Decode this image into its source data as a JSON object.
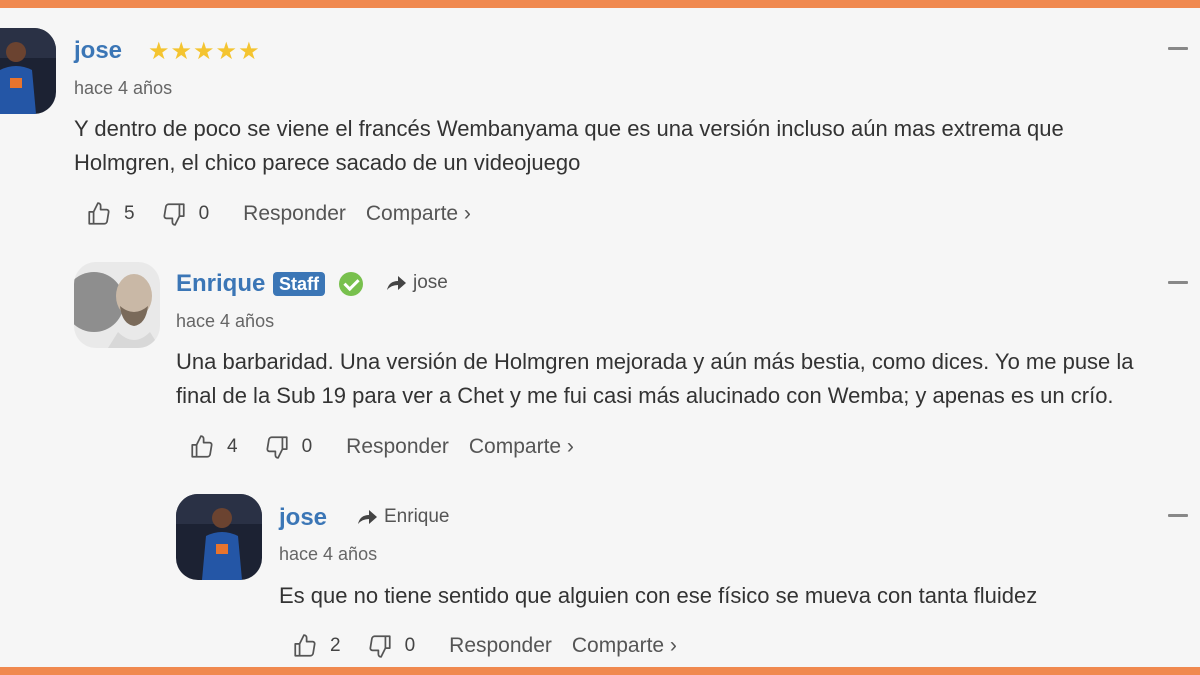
{
  "comments": [
    {
      "author": "jose",
      "rating": "★★★★★",
      "time": "hace 4 años",
      "text_lines": [
        "Y dentro de poco se viene el francés Wembanyama que es una versión incluso aún mas extrema que",
        "Holmgren, el chico parece sacado de un videojuego"
      ],
      "likes": "5",
      "dislikes": "0",
      "reply_label": "Responder",
      "share_label": "Comparte ›"
    },
    {
      "author": "Enrique",
      "badge": "Staff",
      "reply_to": "jose",
      "time": "hace 4 años",
      "text_lines": [
        "Una barbaridad. Una versión de Holmgren mejorada y aún más bestia, como dices. Yo me puse la",
        "final de la Sub 19 para ver a Chet y me fui casi más alucinado con Wemba; y apenas es un crío."
      ],
      "likes": "4",
      "dislikes": "0",
      "reply_label": "Responder",
      "share_label": "Comparte ›"
    },
    {
      "author": "jose",
      "reply_to": "Enrique",
      "time": "hace 4 años",
      "text_lines": [
        "Es que no tiene sentido que alguien con ese físico se mueva con tanta fluidez"
      ],
      "likes": "2",
      "dislikes": "0",
      "reply_label": "Responder",
      "share_label": "Comparte ›"
    }
  ],
  "colors": {
    "accent_border": "#f0894f",
    "author": "#3b76b6",
    "stars": "#f4c430",
    "verified": "#78c04d"
  },
  "icons": [
    "thumbs-up-icon",
    "thumbs-down-icon",
    "reply-arrow-icon",
    "verified-check-icon",
    "minimize-icon"
  ]
}
